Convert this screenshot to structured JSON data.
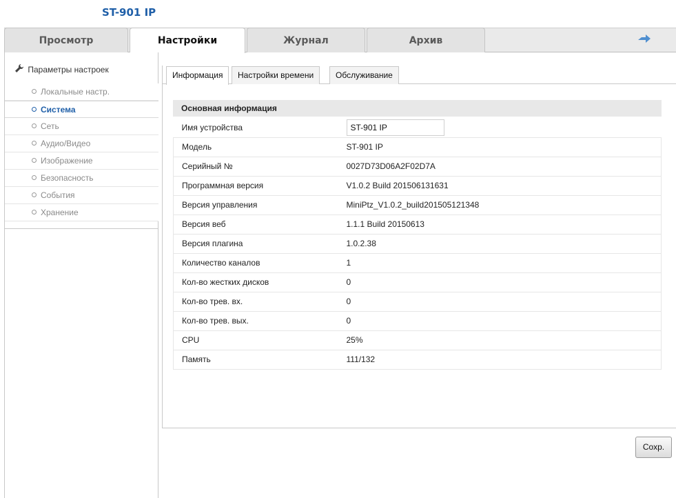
{
  "app": {
    "title": "ST-901 IP"
  },
  "top_tabs": [
    {
      "label": "Просмотр",
      "active": false
    },
    {
      "label": "Настройки",
      "active": true
    },
    {
      "label": "Журнал",
      "active": false
    },
    {
      "label": "Архив",
      "active": false
    }
  ],
  "sidebar": {
    "heading": "Параметры настроек",
    "items": [
      {
        "label": "Локальные настр.",
        "active": false
      },
      {
        "label": "Система",
        "active": true
      },
      {
        "label": "Сеть",
        "active": false
      },
      {
        "label": "Аудио/Видео",
        "active": false
      },
      {
        "label": "Изображение",
        "active": false
      },
      {
        "label": "Безопасность",
        "active": false
      },
      {
        "label": "События",
        "active": false
      },
      {
        "label": "Хранение",
        "active": false
      }
    ]
  },
  "sub_tabs": [
    {
      "label": "Информация",
      "active": true
    },
    {
      "label": "Настройки времени",
      "active": false
    },
    {
      "label": "Обслуживание",
      "active": false
    }
  ],
  "info": {
    "section_title": "Основная информация",
    "device_name_label": "Имя устройства",
    "device_name_value": "ST-901 IP",
    "rows": [
      {
        "label": "Модель",
        "value": "ST-901 IP"
      },
      {
        "label": "Серийный №",
        "value": "0027D73D06A2F02D7A"
      },
      {
        "label": "Программная версия",
        "value": "V1.0.2 Build 201506131631"
      },
      {
        "label": "Версия управления",
        "value": "MiniPtz_V1.0.2_build201505121348"
      },
      {
        "label": "Версия веб",
        "value": "1.1.1 Build 20150613"
      },
      {
        "label": "Версия плагина",
        "value": "1.0.2.38"
      },
      {
        "label": "Количество каналов",
        "value": "1"
      },
      {
        "label": "Кол-во жестких дисков",
        "value": "0"
      },
      {
        "label": "Кол-во трев. вх.",
        "value": "0"
      },
      {
        "label": "Кол-во трев. вых.",
        "value": "0"
      },
      {
        "label": "CPU",
        "value": "25%"
      },
      {
        "label": "Память",
        "value": "111/132"
      }
    ]
  },
  "actions": {
    "save_label": "Сохр."
  },
  "colors": {
    "accent": "#1f5fa8",
    "tab_bar": "#eaeaea",
    "section_header": "#e8e8e8"
  }
}
